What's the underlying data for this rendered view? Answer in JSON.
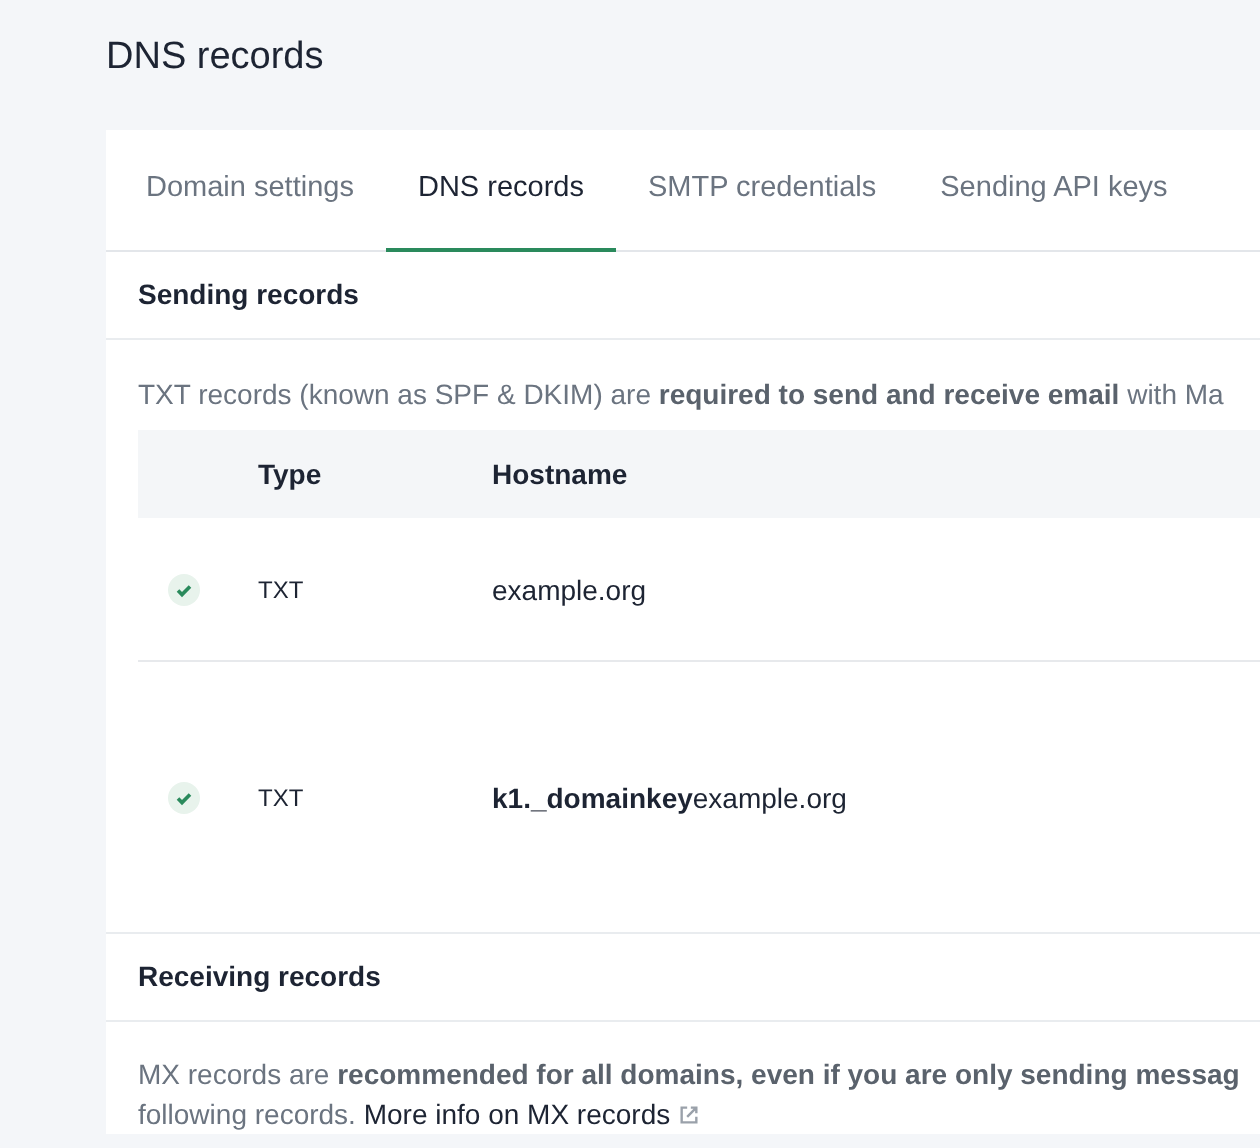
{
  "page_title": "DNS records",
  "tabs": [
    {
      "label": "Domain settings",
      "selected": false
    },
    {
      "label": "DNS records",
      "selected": true
    },
    {
      "label": "SMTP credentials",
      "selected": false
    },
    {
      "label": "Sending API keys",
      "selected": false
    }
  ],
  "sending": {
    "heading": "Sending records",
    "description": "TXT records (known as SPF & DKIM) are **required to send and receive email** with Ma",
    "table": {
      "columns": [
        "Type",
        "Hostname"
      ],
      "rows": [
        {
          "verified": true,
          "type": "TXT",
          "hostname": "example.org"
        },
        {
          "verified": true,
          "type": "TXT",
          "hostname": "**k1._domainkey**example.org"
        }
      ]
    }
  },
  "receiving": {
    "heading": "Receiving records",
    "description_lines": [
      "MX records are **recommended for all domains, even if you are only sending messag**",
      "following records."
    ],
    "link": "More info on MX records"
  }
}
